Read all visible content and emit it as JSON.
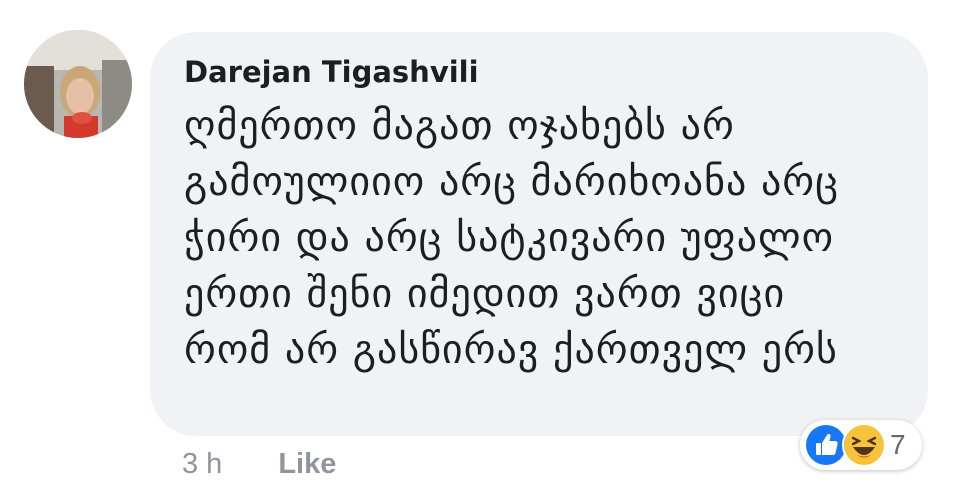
{
  "comment": {
    "author": "Darejan Tigashvili",
    "text": "ღმერთო მაგათ ოჯახებს არ გამოულიიო არც მარიხოანა არც ჭირი და არც სატკივარი უფალო ერთი შენი იმედით ვართ ვიცი რომ არ გასწირავ ქართველ ერს",
    "time": "3 h",
    "like_label": "Like"
  },
  "reactions": {
    "icons": [
      "like-icon",
      "haha-icon"
    ],
    "count": "7",
    "colors": {
      "like": "#1877f2",
      "haha": "#f7c33b"
    }
  },
  "colors": {
    "bubble": "#f0f2f5",
    "author": "#1c1e21",
    "meta": "#90949c"
  }
}
